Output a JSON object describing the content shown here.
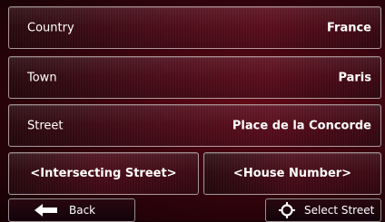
{
  "address_form": {
    "country": {
      "label": "Country",
      "value": "France"
    },
    "town": {
      "label": "Town",
      "value": "Paris"
    },
    "street": {
      "label": "Street",
      "value": "Place de la Concorde"
    }
  },
  "actions": {
    "intersecting_street": "<Intersecting Street>",
    "house_number": "<House Number>"
  },
  "bottom_bar": {
    "back": {
      "label": "Back",
      "icon": "arrow-left-icon"
    },
    "select_street": {
      "label": "Select Street",
      "icon": "crosshair-target-icon"
    }
  },
  "colors": {
    "background": "#3a0912",
    "accent": "#5a0d1c",
    "text": "#ffffff"
  }
}
